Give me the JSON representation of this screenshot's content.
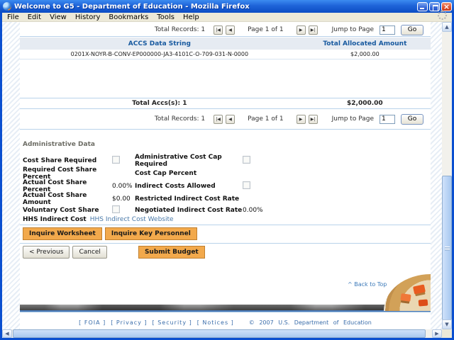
{
  "window": {
    "title": "Welcome to G5 - Department of Education - Mozilla Firefox",
    "menu": [
      "File",
      "Edit",
      "View",
      "History",
      "Bookmarks",
      "Tools",
      "Help"
    ]
  },
  "colors": {
    "titlebar_blue": "#1E63D8",
    "accent_orange": "#F2A94C",
    "link_blue": "#4878A8",
    "table_header_text": "#17599F",
    "separator_blue": "#B9D2EA"
  },
  "pagination_top": {
    "total_records": "Total Records: 1",
    "first_icon": "|◀",
    "prev_icon": "◀",
    "page": "Page 1 of 1",
    "next_icon": "▶",
    "last_icon": "▶|",
    "jump_label": "Jump to Page",
    "jump_value": "1",
    "go": "Go"
  },
  "pagination_bottom": {
    "total_records": "Total Records: 1",
    "first_icon": "|◀",
    "prev_icon": "◀",
    "page": "Page 1 of 1",
    "next_icon": "▶",
    "last_icon": "▶|",
    "jump_label": "Jump to Page",
    "jump_value": "1",
    "go": "Go"
  },
  "table": {
    "headers": [
      "ACCS Data String",
      "Total Allocated Amount"
    ],
    "rows": [
      {
        "accs": "0201X-NOYR-B-CONV-EP000000-JA3-4101C-O-709-031-N-0000",
        "amount": "$2,000.00"
      }
    ],
    "total_label": "Total Accs(s): 1",
    "total_amount": "$2,000.00"
  },
  "admin": {
    "heading": "Administrative Data",
    "rows": [
      {
        "l": "Cost Share Required",
        "r": "Administrative Cost Cap Required"
      },
      {
        "l": "Required Cost Share Percent",
        "r": "Cost Cap Percent"
      },
      {
        "l": "Actual Cost Share Percent",
        "lv": "0.00%",
        "r": "Indirect Costs Allowed"
      },
      {
        "l": "Actual Cost Share Amount",
        "lv": "$0.00",
        "r": "Restricted Indirect Cost Rate"
      },
      {
        "l": "Voluntary Cost Share",
        "r": "Negotiated Indirect Cost Rate",
        "rv": "0.00%"
      }
    ],
    "hhs_label": "HHS Indirect Cost",
    "hhs_link": "HHS Indirect Cost Website"
  },
  "buttons": {
    "inquire_worksheet": "Inquire Worksheet",
    "inquire_key_personnel": "Inquire Key Personnel",
    "previous": "< Previous",
    "cancel": "Cancel",
    "submit": "Submit Budget"
  },
  "back_to_top": "^ Back to Top",
  "footer": {
    "links": [
      "[ FOIA ]",
      "[ Privacy ]",
      "[ Security ]",
      "[ Notices ]"
    ],
    "copyright": "©  2007  U.S.  Department  of  Education"
  }
}
